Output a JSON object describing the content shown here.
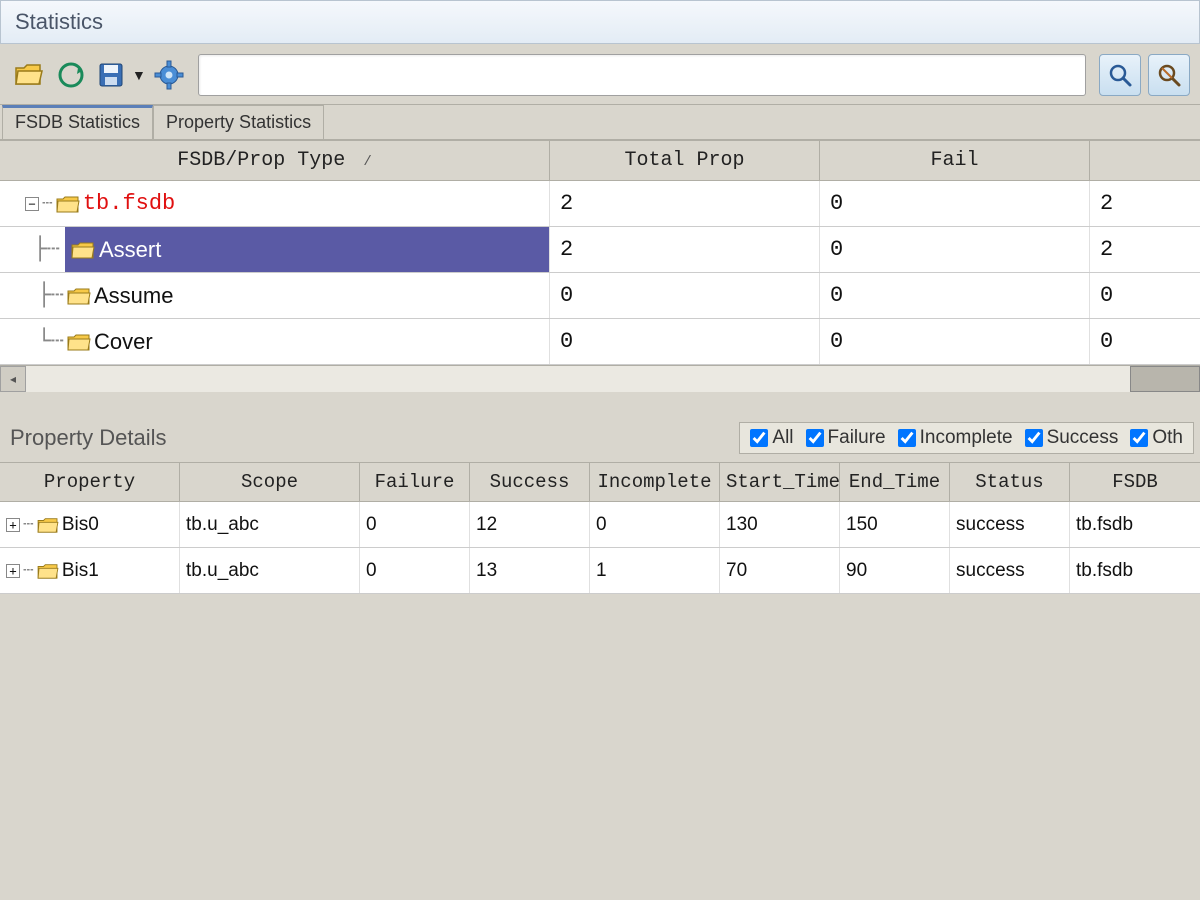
{
  "window": {
    "title": "Statistics"
  },
  "toolbar": {
    "search_value": "",
    "search_placeholder": ""
  },
  "tabs": [
    {
      "label": "FSDB Statistics",
      "active": true
    },
    {
      "label": "Property Statistics",
      "active": false
    }
  ],
  "main_grid": {
    "columns": [
      "FSDB/Prop Type",
      "Total Prop",
      "Fail",
      ""
    ],
    "sort_indicator": "/",
    "rows": [
      {
        "name": "tb.fsdb",
        "level": 0,
        "expandable": true,
        "expanded": true,
        "selected": false,
        "red": true,
        "total": "2",
        "fail": "0",
        "extra": "2"
      },
      {
        "name": "Assert",
        "level": 1,
        "expandable": false,
        "selected": true,
        "total": "2",
        "fail": "0",
        "extra": "2"
      },
      {
        "name": "Assume",
        "level": 1,
        "expandable": false,
        "selected": false,
        "total": "0",
        "fail": "0",
        "extra": "0"
      },
      {
        "name": "Cover",
        "level": 1,
        "expandable": false,
        "selected": false,
        "total": "0",
        "fail": "0",
        "extra": "0"
      }
    ]
  },
  "details": {
    "title": "Property Details",
    "filters": [
      {
        "label": "All",
        "checked": true
      },
      {
        "label": "Failure",
        "checked": true
      },
      {
        "label": "Incomplete",
        "checked": true
      },
      {
        "label": "Success",
        "checked": true
      },
      {
        "label": "Oth",
        "checked": true
      }
    ],
    "columns": [
      "Property",
      "Scope",
      "Failure",
      "Success",
      "Incomplete",
      "Start_Time",
      "End_Time",
      "Status",
      "FSDB"
    ],
    "rows": [
      {
        "property": "Bis0",
        "scope": "tb.u_abc",
        "failure": "0",
        "success": "12",
        "incomplete": "0",
        "start": "130",
        "end": "150",
        "status": "success",
        "fsdb": "tb.fsdb"
      },
      {
        "property": "Bis1",
        "scope": "tb.u_abc",
        "failure": "0",
        "success": "13",
        "incomplete": "1",
        "start": "70",
        "end": "90",
        "status": "success",
        "fsdb": "tb.fsdb"
      }
    ]
  },
  "icons": {
    "folder": "folder-icon",
    "refresh": "refresh-icon",
    "save": "save-icon",
    "gear": "gear-icon",
    "search": "search-icon",
    "search_adv": "search-advanced-icon"
  }
}
